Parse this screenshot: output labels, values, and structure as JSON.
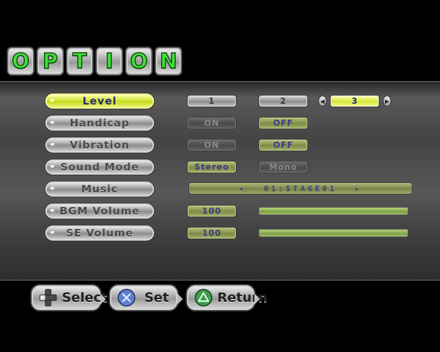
{
  "title": {
    "letters": [
      "O",
      "P",
      "T",
      "I",
      "O",
      "N"
    ],
    "letter_color": "#3fe03a"
  },
  "rows": {
    "level": {
      "label": "Level",
      "options": [
        "1",
        "2",
        "3"
      ],
      "selected": "3"
    },
    "handicap": {
      "label": "Handicap",
      "options": [
        "ON",
        "OFF"
      ],
      "selected": "OFF"
    },
    "vibration": {
      "label": "Vibration",
      "options": [
        "ON",
        "OFF"
      ],
      "selected": "OFF"
    },
    "sound_mode": {
      "label": "Sound Mode",
      "options": [
        "Stereo",
        "Mono"
      ],
      "selected": "Stereo"
    },
    "music": {
      "label": "Music",
      "value": "01:STAGE01",
      "prev_icon": "arrow-left-icon",
      "next_icon": "arrow-right-icon"
    },
    "bgm_volume": {
      "label": "BGM Volume",
      "value": "100",
      "level_percent": 100
    },
    "se_volume": {
      "label": "SE Volume",
      "value": "100",
      "level_percent": 100
    }
  },
  "controls": {
    "select": {
      "label": "Select",
      "icon": "dpad-icon"
    },
    "set": {
      "label": "Set",
      "icon": "cross-button-icon"
    },
    "return": {
      "label": "Return",
      "icon": "triangle-button-icon"
    }
  },
  "colors": {
    "highlight": "#d8e83a",
    "green_option": "#8f9c54",
    "volume_fill": "#9aba5c"
  }
}
